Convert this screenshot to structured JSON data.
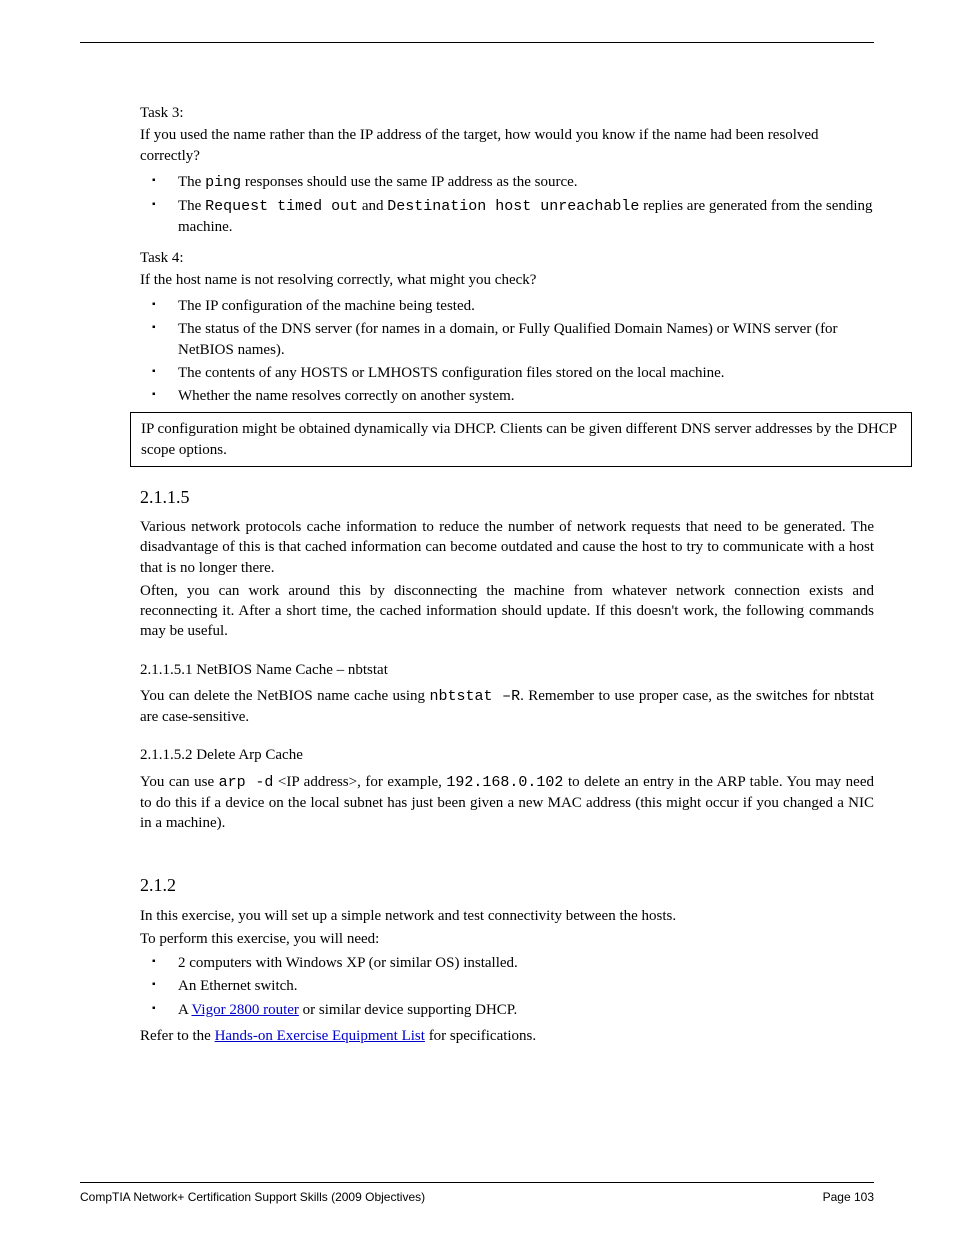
{
  "q1": {
    "pre": "Task 3:",
    "text": "If you used the name rather than the IP address of the target, how would you know if the name had been resolved correctly?",
    "bullets": [
      {
        "t1": "The ",
        "c1": "ping",
        "t2": " responses should use the same IP address as the source."
      },
      {
        "t1": "The ",
        "c1": "Request timed out",
        "t2": " and ",
        "c2": "Destination host unreachable",
        "t3": " replies are generated from the sending machine."
      }
    ]
  },
  "q2": {
    "pre": "Task 4:",
    "text": "If the host name is not resolving correctly, what might you check?",
    "bullets": [
      "The IP configuration of the machine being tested.",
      "The status of the DNS server (for names in a domain, or Fully Qualified Domain Names) or WINS server (for NetBIOS names).",
      "The contents of any HOSTS or LMHOSTS configuration files stored on the local machine."
    ],
    "lastPlain": "Whether the name resolves correctly on another system.",
    "box": "IP configuration might be obtained dynamically via DHCP. Clients can be given different DNS server addresses by the DHCP scope options."
  },
  "s1": {
    "h": "2.1.1.5",
    "p1": "Various network protocols cache information to reduce the number of network requests that need to be generated. The disadvantage of this is that cached information can become outdated and cause the host to try to communicate with a host that is no longer there.",
    "p2": "Often, you can work around this by disconnecting the machine from whatever network connection exists and reconnecting it. After a short time, the cached information should update. If this doesn't work, the following commands may be useful.",
    "sub1": "2.1.1.5.1 NetBIOS Name Cache – nbtstat",
    "p3a": "You can delete the NetBIOS name cache using ",
    "c3": "nbtstat –R",
    "p3b": ". Remember to use proper case, as the switches for nbtstat are case-sensitive. ",
    "sub2": "2.1.1.5.2 Delete Arp Cache",
    "p4a": "You can use ",
    "c4a": "arp -d",
    "p4b": " <IP address>, for example, ",
    "c4b": "192.168.0.102",
    "p4c": " to delete an entry in the ARP table. You may need to do this if a device on the local subnet has just been given a new MAC address (this might occur if you changed a NIC in a machine)."
  },
  "s2": {
    "h": "2.1.2",
    "p1": "In this exercise, you will set up a simple network and test connectivity between the hosts.",
    "p2": "To perform this exercise, you will need:",
    "bullets": [
      "2 computers with Windows XP (or similar OS) installed.",
      "An Ethernet switch.",
      {
        "t1": "A ",
        "link": "Vigor 2800 router",
        "t2": " or similar device supporting DHCP."
      }
    ],
    "p3a": "Refer to the ",
    "link": "Hands-on Exercise Equipment List",
    "p3b": " for specifications."
  },
  "footer": {
    "left": "CompTIA Network+ Certification Support Skills (2009 Objectives)",
    "right": "Page 103"
  }
}
